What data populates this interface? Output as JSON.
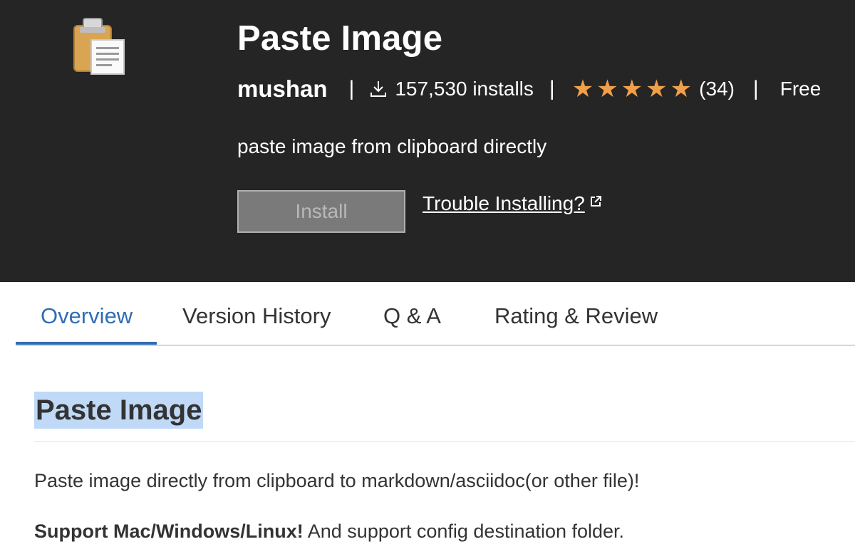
{
  "extension": {
    "icon": "clipboard-icon",
    "title": "Paste Image",
    "publisher": "mushan",
    "installs": "157,530 installs",
    "rating_count": "(34)",
    "rating_stars": 5,
    "price": "Free",
    "description": "paste image from clipboard directly",
    "install_label": "Install",
    "trouble_label": "Trouble Installing?"
  },
  "tabs": [
    {
      "label": "Overview",
      "active": true
    },
    {
      "label": "Version History",
      "active": false
    },
    {
      "label": "Q & A",
      "active": false
    },
    {
      "label": "Rating & Review",
      "active": false
    }
  ],
  "overview": {
    "heading": "Paste Image",
    "paragraph1": "Paste image directly from clipboard to markdown/asciidoc(or other file)!",
    "paragraph2_bold": "Support Mac/Windows/Linux!",
    "paragraph2_rest": " And support config destination folder."
  },
  "colors": {
    "header_bg": "#252526",
    "accent": "#2f6db5",
    "star": "#f0a04a",
    "highlight": "#bfd9f7"
  }
}
